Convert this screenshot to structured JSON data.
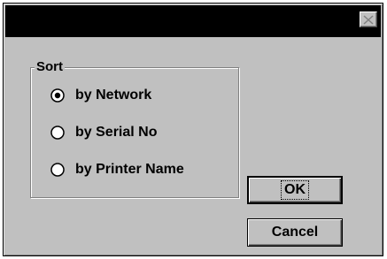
{
  "window": {
    "close_icon": "close-icon"
  },
  "sort_group": {
    "legend": "Sort",
    "options": [
      {
        "label": "by Network",
        "selected": true
      },
      {
        "label": "by Serial No",
        "selected": false
      },
      {
        "label": "by Printer Name",
        "selected": false
      }
    ]
  },
  "buttons": {
    "ok": "OK",
    "cancel": "Cancel"
  }
}
